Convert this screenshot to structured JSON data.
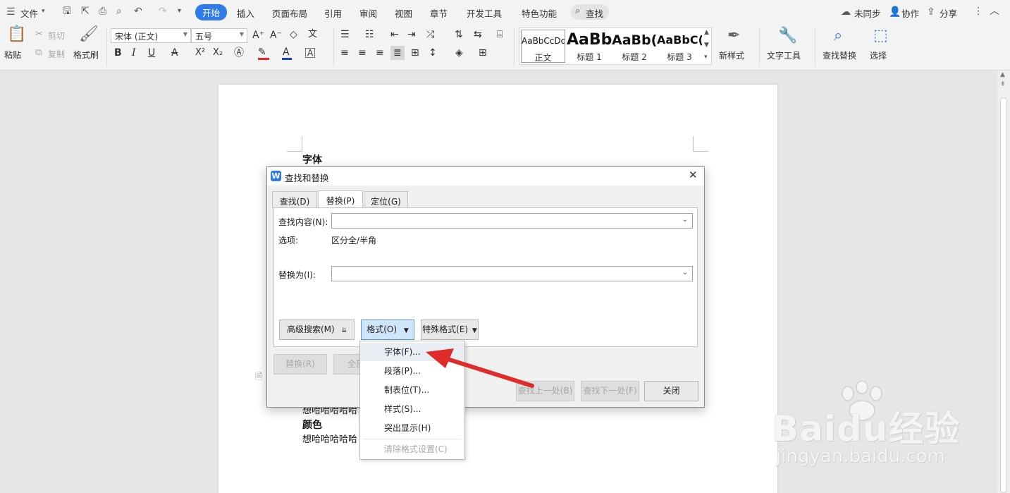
{
  "menubar": {
    "file_label": "文件",
    "tabs": [
      "开始",
      "插入",
      "页面布局",
      "引用",
      "审阅",
      "视图",
      "章节",
      "开发工具",
      "特色功能"
    ],
    "search_label": "查找",
    "sync_label": "未同步",
    "collab_label": "协作",
    "share_label": "分享"
  },
  "ribbon": {
    "paste_label": "粘贴",
    "cut_label": "剪切",
    "copy_label": "复制",
    "format_painter_label": "格式刷",
    "font_name": "宋体 (正文)",
    "font_size": "五号",
    "styles": [
      {
        "preview": "AaBbCcDd",
        "name": "正文"
      },
      {
        "preview": "AaBb",
        "name": "标题 1"
      },
      {
        "preview": "AaBb(",
        "name": "标题 2"
      },
      {
        "preview": "AaBbC(",
        "name": "标题 3"
      }
    ],
    "new_style_label": "新样式",
    "text_tools_label": "文字工具",
    "find_replace_label": "查找替换",
    "select_label": "选择"
  },
  "document": {
    "heading_font": "字体",
    "body_line_1": "想哈哈哈哈哈",
    "heading_color": "颜色",
    "body_line_2": "想哈哈哈哈哈"
  },
  "dialog": {
    "title": "查找和替换",
    "tabs": [
      "查找(D)",
      "替换(P)",
      "定位(G)"
    ],
    "find_label": "查找内容(N):",
    "find_value": "",
    "options_label": "选项:",
    "options_value": "区分全/半角",
    "replace_label": "替换为(I):",
    "replace_value": "",
    "advanced_button": "高级搜索(M)",
    "format_button": "格式(O)",
    "special_button": "特殊格式(E)",
    "replace_button": "替换(R)",
    "replace_all_button": "全部替",
    "find_prev_button": "查找上一处(B)",
    "find_next_button": "查找下一处(F)",
    "close_button": "关闭"
  },
  "format_menu": {
    "items": [
      "字体(F)...",
      "段落(P)...",
      "制表位(T)...",
      "样式(S)...",
      "突出显示(H)",
      "清除格式设置(C)"
    ]
  },
  "watermark": {
    "brand": "Baidu经验",
    "url": "jingyan.baidu.com"
  },
  "colors": {
    "accent": "#2f7bea",
    "arrow": "#e02b2b",
    "font_color_bar": "#1f3fbf",
    "highlight_bar": "#e8242c"
  }
}
